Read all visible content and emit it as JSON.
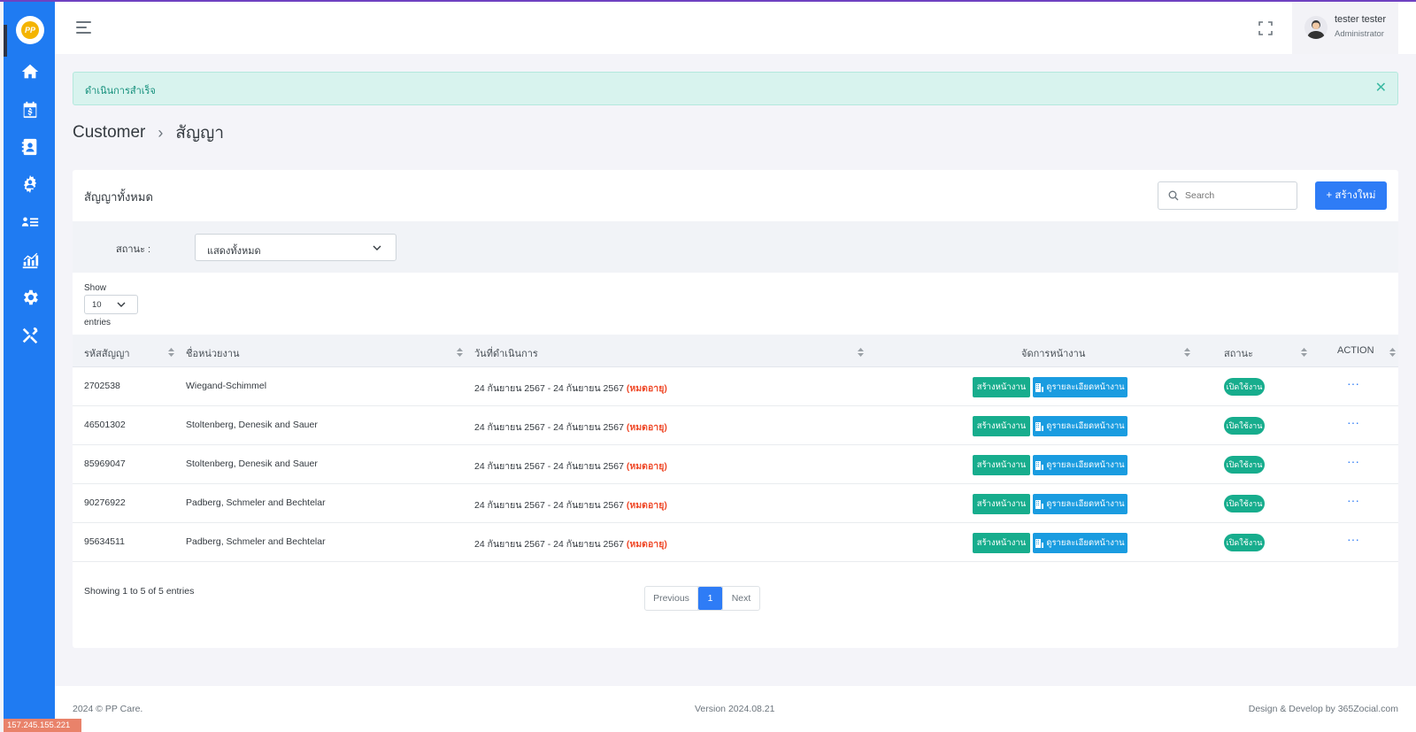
{
  "colors": {
    "sidebar": "#1f7bf2",
    "primary": "#2e7cf6",
    "success": "#17ad8d",
    "info": "#1a9ce0",
    "expired": "#ef4b2b",
    "alert_bg": "#d8f3ee"
  },
  "logo": {
    "text": "PP"
  },
  "sidebar": {
    "items": [
      {
        "icon": "home-icon"
      },
      {
        "icon": "calendar-dollar-icon"
      },
      {
        "icon": "contact-book-icon"
      },
      {
        "icon": "users-gear-icon"
      },
      {
        "icon": "list-users-icon"
      },
      {
        "icon": "chart-icon"
      },
      {
        "icon": "gear-icon"
      },
      {
        "icon": "tools-icon"
      }
    ]
  },
  "user": {
    "name": "tester tester",
    "role": "Administrator"
  },
  "alert": {
    "message": "ดำเนินการสำเร็จ"
  },
  "breadcrumb": {
    "parent": "Customer",
    "current": "สัญญา"
  },
  "card": {
    "title": "สัญญาทั้งหมด",
    "search_placeholder": "Search",
    "new_button": "+  สร้างใหม่"
  },
  "filter": {
    "label": "สถานะ :",
    "value": "แสดงทั้งหมด"
  },
  "length": {
    "show": "Show",
    "value": "10",
    "entries": "entries"
  },
  "table": {
    "headers": [
      "รหัสสัญญา",
      "ชื่อหน่วยงาน",
      "วันที่ดำเนินการ",
      "จัดการหน้างาน",
      "สถานะ",
      "ACTION"
    ],
    "rows": [
      {
        "code": "2702538",
        "name": "Wiegand-Schimmel",
        "date": "24 กันยายน 2567 - 24 กันยายน 2567",
        "expired": "(หมดอายุ)",
        "create": "สร้างหน้างาน",
        "view": "ดูรายละเอียดหน้างาน",
        "status": "เปิดใช้งาน",
        "action": "···"
      },
      {
        "code": "46501302",
        "name": "Stoltenberg, Denesik and Sauer",
        "date": "24 กันยายน 2567 - 24 กันยายน 2567",
        "expired": "(หมดอายุ)",
        "create": "สร้างหน้างาน",
        "view": "ดูรายละเอียดหน้างาน",
        "status": "เปิดใช้งาน",
        "action": "···"
      },
      {
        "code": "85969047",
        "name": "Stoltenberg, Denesik and Sauer",
        "date": "24 กันยายน 2567 - 24 กันยายน 2567",
        "expired": "(หมดอายุ)",
        "create": "สร้างหน้างาน",
        "view": "ดูรายละเอียดหน้างาน",
        "status": "เปิดใช้งาน",
        "action": "···"
      },
      {
        "code": "90276922",
        "name": "Padberg, Schmeler and Bechtelar",
        "date": "24 กันยายน 2567 - 24 กันยายน 2567",
        "expired": "(หมดอายุ)",
        "create": "สร้างหน้างาน",
        "view": "ดูรายละเอียดหน้างาน",
        "status": "เปิดใช้งาน",
        "action": "···"
      },
      {
        "code": "95634511",
        "name": "Padberg, Schmeler and Bechtelar",
        "date": "24 กันยายน 2567 - 24 กันยายน 2567",
        "expired": "(หมดอายุ)",
        "create": "สร้างหน้างาน",
        "view": "ดูรายละเอียดหน้างาน",
        "status": "เปิดใช้งาน",
        "action": "···"
      }
    ]
  },
  "pagination": {
    "info": "Showing 1 to 5 of 5 entries",
    "previous": "Previous",
    "current": "1",
    "next": "Next"
  },
  "footer": {
    "copyright": "2024 © PP Care.",
    "version": "Version 2024.08.21",
    "credit": "Design & Develop by 365Zocial.com"
  },
  "ip": "157.245.155.221"
}
